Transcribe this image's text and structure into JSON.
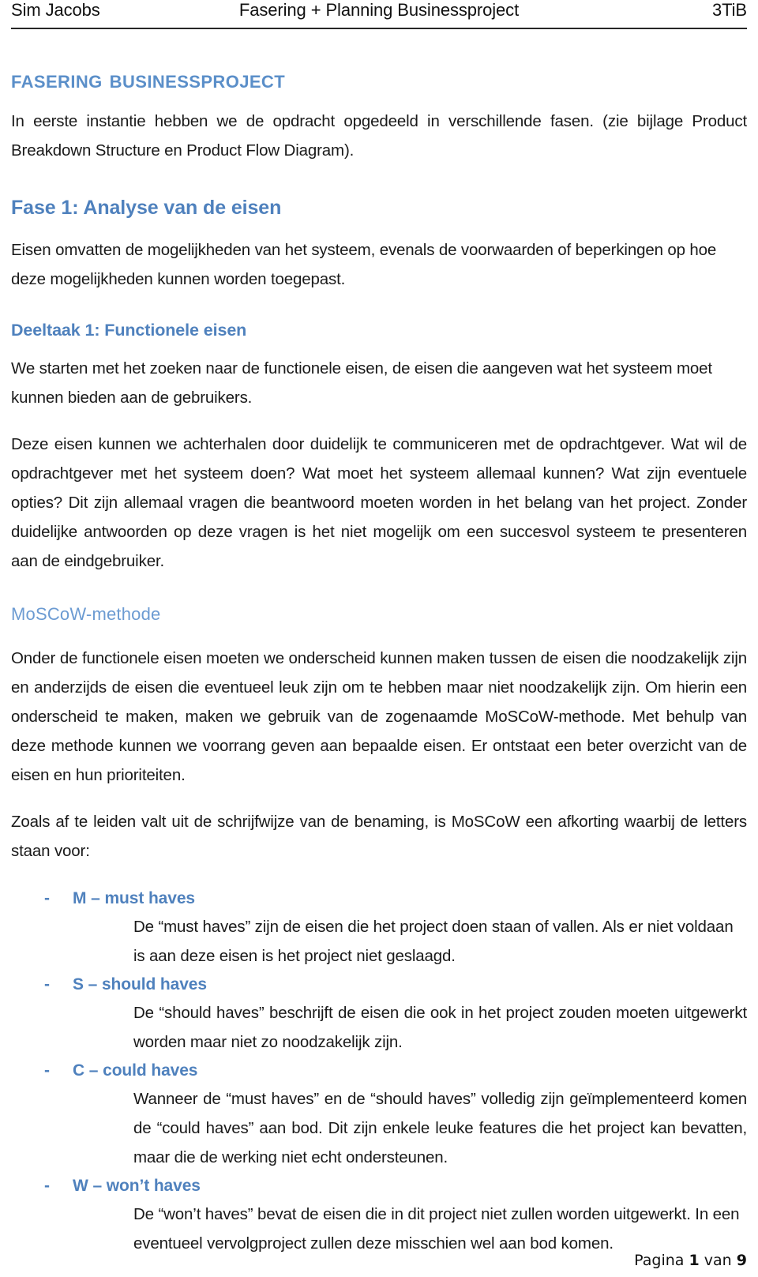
{
  "header": {
    "left": "Sim Jacobs",
    "center": "Fasering + Planning Businessproject",
    "right": "3TiB"
  },
  "document": {
    "title": "Fasering Businessproject",
    "intro": "In eerste instantie hebben we de opdracht opgedeeld in verschillende fasen. (zie bijlage Product Breakdown Structure en Product Flow Diagram).",
    "fase_heading": "Fase 1: Analyse van de eisen",
    "fase_body": "Eisen omvatten de mogelijkheden van het systeem, evenals de voorwaarden of beperkingen op hoe deze mogelijkheden kunnen worden toegepast.",
    "deeltaak_heading": "Deeltaak 1: Functionele eisen",
    "deeltaak_body": "We starten met het zoeken naar de functionele eisen, de eisen die aangeven wat het systeem moet kunnen bieden aan de gebruikers.",
    "deeltaak_body2": "Deze eisen kunnen we achterhalen door duidelijk te communiceren met de opdrachtgever. Wat wil de opdrachtgever met het systeem doen? Wat moet het systeem allemaal kunnen? Wat zijn eventuele opties? Dit zijn allemaal vragen die beantwoord moeten worden in het belang van het project. Zonder duidelijke antwoorden op deze vragen is het niet mogelijk om een succesvol systeem te presenteren aan de eindgebruiker.",
    "moscow_heading": "MoSCoW-methode",
    "moscow_body": "Onder de functionele eisen moeten we onderscheid kunnen maken tussen de eisen die noodzakelijk zijn en anderzijds de eisen die eventueel leuk zijn om te hebben maar niet noodzakelijk zijn. Om hierin een onderscheid te maken, maken we gebruik van de zogenaamde MoSCoW-methode. Met behulp van deze methode kunnen we voorrang geven aan bepaalde eisen. Er ontstaat een beter overzicht van de eisen en hun prioriteiten.",
    "moscow_intro": "Zoals af te leiden valt uit de schrijfwijze van de benaming, is MoSCoW een afkorting waarbij de letters staan voor:"
  },
  "moscow_items": [
    {
      "bullet": "-",
      "term": "M – must haves",
      "desc": "De “must haves” zijn de eisen die het project doen staan of vallen. Als er niet voldaan is aan deze eisen is het project niet geslaagd."
    },
    {
      "bullet": "-",
      "term": "S – should haves",
      "desc": "De “should haves” beschrijft de eisen die ook in het project zouden moeten uitgewerkt worden maar niet zo noodzakelijk zijn."
    },
    {
      "bullet": "-",
      "term": "C – could haves",
      "desc": "Wanneer de “must haves” en de “should haves” volledig zijn geïmplementeerd komen de “could haves” aan bod. Dit zijn enkele leuke features die het project kan bevatten, maar die de werking niet echt ondersteunen."
    },
    {
      "bullet": "-",
      "term": "W – won’t haves",
      "desc": "De “won’t haves” bevat de eisen die in dit project niet zullen worden uitgewerkt. In een eventueel vervolgproject zullen deze misschien wel aan bod komen."
    }
  ],
  "footer": {
    "prefix": "Pagina",
    "page": "1",
    "middle": "van",
    "total": "9"
  },
  "colors": {
    "heading_blue": "#4F81BD",
    "title_blue": "#5B8FC9",
    "subtle_blue": "#6C9BD2",
    "body_text": "#1a1a1a"
  }
}
